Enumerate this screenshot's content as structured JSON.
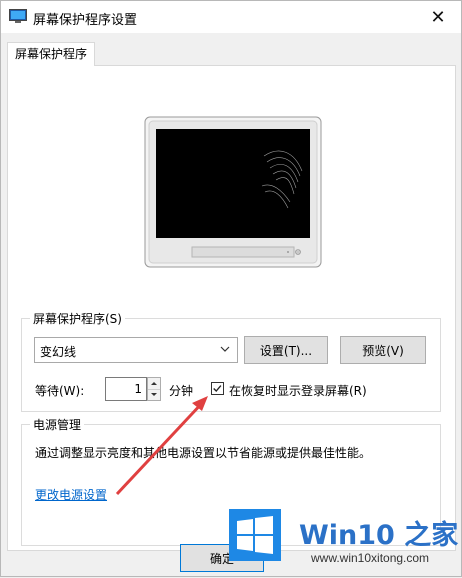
{
  "window": {
    "title": "屏幕保护程序设置",
    "close_glyph": "✕"
  },
  "tab": {
    "label": "屏幕保护程序"
  },
  "screensaver_group": {
    "title": "屏幕保护程序(S)",
    "selected": "变幻线",
    "settings_button": "设置(T)...",
    "preview_button": "预览(V)",
    "wait_label": "等待(W):",
    "wait_value": "1",
    "wait_unit": "分钟",
    "resume_checkbox_label": "在恢复时显示登录屏幕(R)",
    "resume_checked": true
  },
  "power_group": {
    "title": "电源管理",
    "description": "通过调整显示亮度和其他电源设置以节省能源或提供最佳性能。",
    "link": "更改电源设置"
  },
  "footer": {
    "ok_button": "确定"
  },
  "watermark": {
    "brand": "Win10 之家",
    "url": "www.win10xitong.com"
  },
  "colors": {
    "accent": "#0078d7",
    "link": "#0066cc",
    "annotation_arrow": "#e04040",
    "watermark_blue": "#2b71c7"
  }
}
